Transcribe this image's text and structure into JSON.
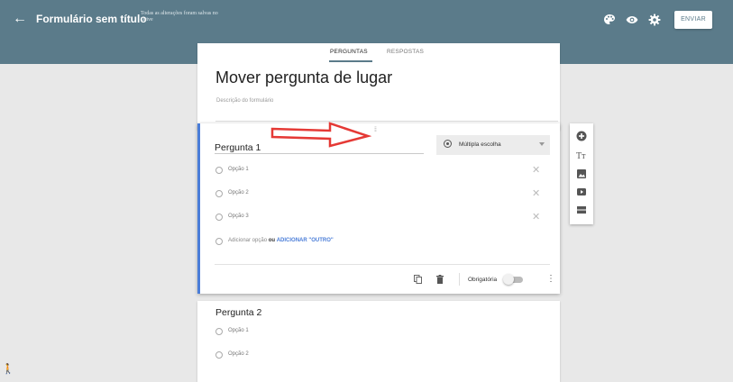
{
  "header": {
    "back_glyph": "←",
    "title": "Formulário sem título",
    "save_note": "Todas as alterações foram salvas no Drive",
    "send_label": "ENVIAR",
    "icons": [
      "palette-icon",
      "eye-preview-icon",
      "gear-icon"
    ],
    "bar_color": "#5b7b8a"
  },
  "tabs": [
    {
      "label": "PERGUNTAS",
      "active": true
    },
    {
      "label": "RESPOSTAS",
      "active": false
    }
  ],
  "form": {
    "title": "Mover pergunta de lugar",
    "description_placeholder": "Descrição do formulário"
  },
  "question1": {
    "drag_handle": "⁞⁞",
    "title": "Pergunta 1",
    "type_label": "Múltipla escolha",
    "options": [
      {
        "label": "Opção 1",
        "remove": "✕"
      },
      {
        "label": "Opção 2",
        "remove": "✕"
      },
      {
        "label": "Opção 3",
        "remove": "✕"
      }
    ],
    "add_option": "Adicionar opção",
    "add_or": "ou",
    "add_other": "ADICIONAR \"OUTRO\"",
    "required_label": "Obrigatória",
    "required": false,
    "more_glyph": "⋮",
    "accent_color": "#4a7dd8"
  },
  "question2": {
    "title": "Pergunta 2",
    "options": [
      "Opção 1",
      "Opção 2"
    ]
  },
  "side_toolbar": [
    "add-question-icon",
    "add-title-icon",
    "add-image-icon",
    "add-video-icon",
    "add-section-icon"
  ],
  "annotation": {
    "arrow_color": "#e53935"
  },
  "accessibility": {
    "glyph": "🚶"
  }
}
